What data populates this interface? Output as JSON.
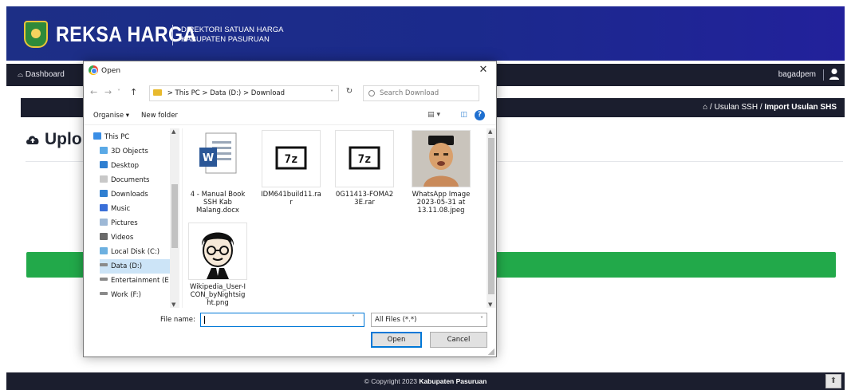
{
  "app": {
    "brand": "REKSA HARGA",
    "subtitle_line1": "DIREKTORI SATUAN HARGA",
    "subtitle_line2": "KABUPATEN PASURUAN"
  },
  "navbar": {
    "dashboard": "Dashboard",
    "username": "bagadpem"
  },
  "breadcrumb": {
    "home_sep": "/",
    "item1": "Usulan SSH",
    "sep2": "/",
    "item2": "Import Usulan SHS"
  },
  "page": {
    "title": "Uplo"
  },
  "footer": {
    "copyright": "© Copyright 2023",
    "owner": "Kabupaten Pasuruan"
  },
  "dialog": {
    "title": "Open",
    "close": "✕",
    "address": {
      "parts": [
        "This PC",
        ">",
        "Data (D:)",
        ">",
        "Download"
      ]
    },
    "search_placeholder": "Search Download",
    "toolbar": {
      "organise": "Organise ▾",
      "new_folder": "New folder"
    },
    "nav_items": [
      {
        "label": "This PC",
        "icon": "computer-icon",
        "color": "#3a8ee6"
      },
      {
        "label": "3D Objects",
        "icon": "cube-icon",
        "color": "#5aa9e6"
      },
      {
        "label": "Desktop",
        "icon": "desktop-icon",
        "color": "#2f7fd1"
      },
      {
        "label": "Documents",
        "icon": "document-icon",
        "color": "#c8c8c8"
      },
      {
        "label": "Downloads",
        "icon": "download-icon",
        "color": "#2f7fd1"
      },
      {
        "label": "Music",
        "icon": "music-icon",
        "color": "#3a6fd8"
      },
      {
        "label": "Pictures",
        "icon": "picture-icon",
        "color": "#9db8d6"
      },
      {
        "label": "Videos",
        "icon": "video-icon",
        "color": "#6a6a6a"
      },
      {
        "label": "Local Disk (C:)",
        "icon": "disk-icon",
        "color": "#6cb0e0"
      },
      {
        "label": "Data (D:)",
        "icon": "drive-icon",
        "color": "#8a8a8a"
      },
      {
        "label": "Entertainment (E",
        "icon": "drive-icon",
        "color": "#8a8a8a"
      },
      {
        "label": "Work (F:)",
        "icon": "drive-icon",
        "color": "#8a8a8a"
      }
    ],
    "files": [
      {
        "name": "4 - Manual Book SSH Kab Malang.docx",
        "type": "word-document-icon"
      },
      {
        "name": "IDM641build11.rar",
        "type": "archive-icon"
      },
      {
        "name": "0G11413-FOMA23E.rar",
        "type": "archive-icon"
      },
      {
        "name": "WhatsApp Image 2023-05-31 at 13.11.08.jpeg",
        "type": "image-thumbnail"
      },
      {
        "name": "Wikipedia_User-ICON_byNightsight.png",
        "type": "image-thumbnail"
      }
    ],
    "file_labels": {
      "f1": "4 - Manual Book SSH Kab Malang.docx",
      "f2": "IDM641build11.ra r",
      "f3": "0G11413-FOMA2 3E.rar",
      "f4": "WhatsApp Image 2023-05-31 at 13.11.08.jpeg",
      "f5": "Wikipedia_User-I CON_byNightsig ht.png"
    },
    "archive_glyph": "7z",
    "file_name_label": "File name:",
    "file_name_value": "",
    "file_type": "All Files (*.*)",
    "open_button": "Open",
    "cancel_button": "Cancel"
  },
  "colors": {
    "header_blue": "#1d2f86",
    "dark_bar": "#1b1e2e",
    "green_bar": "#22a94a",
    "selection": "#cce4f7",
    "focus_blue": "#0078d7"
  }
}
